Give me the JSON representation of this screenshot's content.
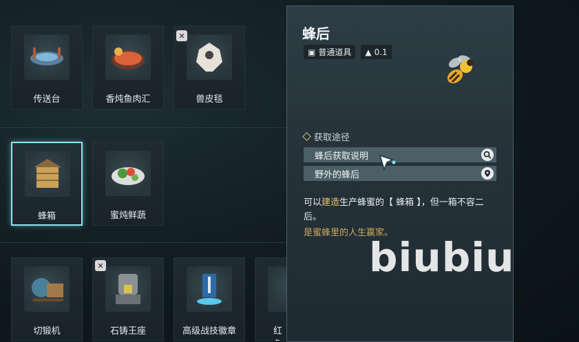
{
  "grid": {
    "items": [
      {
        "label": "传送台",
        "icon": "teleporter-icon"
      },
      {
        "label": "香炖鱼肉汇",
        "icon": "fish-stew-icon"
      },
      {
        "label": "兽皮毯",
        "icon": "fur-rug-icon"
      },
      {
        "label": "蜂箱",
        "icon": "beehive-icon"
      },
      {
        "label": "蜜炖鲜蔬",
        "icon": "honey-veggies-icon"
      },
      {
        "label": "切锻机",
        "icon": "forge-machine-icon"
      },
      {
        "label": "石铸王座",
        "icon": "stone-throne-icon"
      },
      {
        "label": "高级战技徽章",
        "icon": "combat-badge-icon"
      },
      {
        "label": "红色",
        "icon": "red-item-icon"
      }
    ]
  },
  "detail": {
    "title": "蜂后",
    "category": "普通道具",
    "weight": "0.1",
    "section_title": "获取途径",
    "sources": [
      {
        "label": "蜂后获取说明",
        "icon": "search-icon"
      },
      {
        "label": "野外的蜂后",
        "icon": "map-pin-icon"
      }
    ],
    "desc_prefix": "可以",
    "desc_highlight": "建造",
    "desc_rest": "生产蜂蜜的【 蜂箱 】，但一箱不容二后。",
    "flavor": "是蜜蜂里的人生赢家。"
  },
  "watermark": "biubiu",
  "colors": {
    "selected_border": "#8fe7f2",
    "highlight": "#e6c56a"
  }
}
